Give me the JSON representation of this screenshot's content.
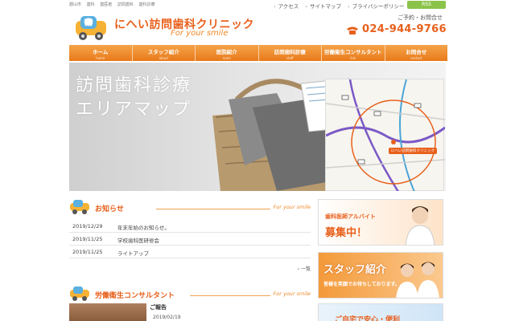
{
  "header": {
    "keywords": [
      "郡山市",
      "歯科",
      "歯医者",
      "訪問歯科",
      "歯科診療"
    ],
    "top_links": [
      "アクセス",
      "サイトマップ",
      "プライバシーポリシー"
    ],
    "rss_label": "RSS",
    "logo_title": "にへい訪問歯科クリニック",
    "logo_subtitle": "For your smile",
    "contact_label": "ご予約・お問合せ",
    "phone": "024-944-9766"
  },
  "nav": {
    "items": [
      {
        "label": "ホーム",
        "sub": "home"
      },
      {
        "label": "スタッフ紹介",
        "sub": "about"
      },
      {
        "label": "医院紹介",
        "sub": "room"
      },
      {
        "label": "訪問歯科診療",
        "sub": "staff"
      },
      {
        "label": "労働衛生コンサルタント",
        "sub": "link"
      },
      {
        "label": "お問合せ",
        "sub": "contact"
      }
    ]
  },
  "hero": {
    "title_line1": "訪問歯科診療",
    "title_line2": "エリアマップ",
    "map_badge": "にへい訪問歯科クリニック"
  },
  "news": {
    "title": "お知らせ",
    "tagline": "For your smile",
    "items": [
      {
        "date": "2019/12/29",
        "title": "年末年始のお知らせ。"
      },
      {
        "date": "2019/11/25",
        "title": "学校歯科医研修会"
      },
      {
        "date": "2019/11/25",
        "title": "ライトアップ"
      }
    ],
    "more_label": "一覧"
  },
  "consultant": {
    "title": "労働衛生コンサルタント",
    "tagline": "For your smile",
    "report_title": "ご報告",
    "report_date": "2019/02/19"
  },
  "banners": {
    "recruit_small": "歯科医師アルバイト",
    "recruit_big": "募集中！",
    "staff_big": "スタッフ紹介",
    "staff_small": "皆様を笑顔でお待ちしております。",
    "home_text": "ご自宅で安心・便利"
  },
  "colors": {
    "accent": "#e8601c",
    "nav_top": "#f5a34a",
    "nav_bottom": "#e87a1a",
    "rss": "#8bc34a"
  }
}
